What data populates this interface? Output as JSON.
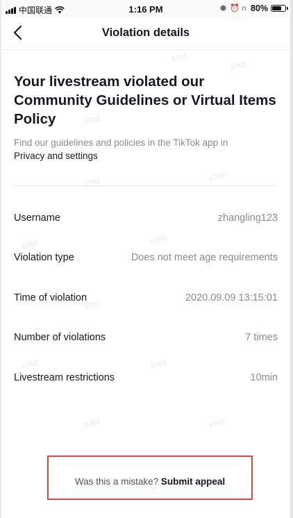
{
  "status_bar": {
    "carrier": "中国联通",
    "time": "1:16 PM",
    "battery": "80%",
    "battery_level": 0.8,
    "icons": [
      "signal-icon",
      "wifi-icon",
      "orientation-lock-icon",
      "alarm-icon",
      "headphones-icon",
      "battery-icon"
    ]
  },
  "nav": {
    "title": "Violation details",
    "back_icon": "chevron-left-icon"
  },
  "headline": "Your livestream violated our Community Guidelines or Virtual Items Policy",
  "guidelines": {
    "text": "Find our guidelines and policies in the TikTok app in",
    "link": "Privacy and settings"
  },
  "details": [
    {
      "label": "Username",
      "value": "zhangling123"
    },
    {
      "label": "Violation type",
      "value": "Does not meet age requirements"
    },
    {
      "label": "Time of violation",
      "value": "2020.09.09 13:15:01"
    },
    {
      "label": "Number of violations",
      "value": "7 times"
    },
    {
      "label": "Livestream restrictions",
      "value": "10min"
    }
  ],
  "appeal": {
    "prompt": "Was this a mistake?",
    "link": "Submit appeal"
  },
  "watermark": "6763",
  "colors": {
    "text_primary": "#161823",
    "text_secondary": "#8a8b91",
    "highlight_border": "#e04545"
  }
}
